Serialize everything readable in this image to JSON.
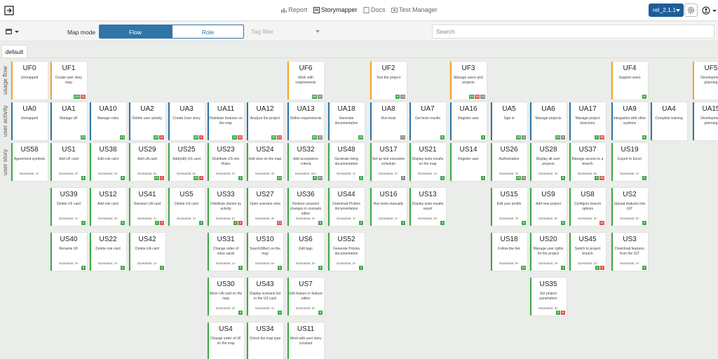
{
  "nav": {
    "report": "Report",
    "storymapper": "Storymapper",
    "docs": "Docs",
    "test_manager": "Test Manager"
  },
  "release": "rel_2.1.1",
  "toolbar": {
    "map_mode_label": "Map mode",
    "flow_label": "Flow",
    "role_label": "Role",
    "tag_filter_placeholder": "Tag filter",
    "search_placeholder": "Search"
  },
  "tab": "default",
  "row_labels": {
    "uf": "usage flow",
    "ua": "user activity",
    "us": "user story"
  },
  "colors": {
    "uf_bar": "#f4a52c",
    "ua_bar": "#2f75a6",
    "us_bar": "#3ea845",
    "green": "#3ea845",
    "red": "#e05050",
    "gray": "#888888"
  },
  "uf_cards": [
    {
      "id": "UF0",
      "desc": "Unmapped",
      "col": 0
    },
    {
      "id": "UF1",
      "desc": "Create user story map",
      "col": 1,
      "badges": [
        [
          "115",
          "green"
        ],
        [
          "10",
          "red"
        ]
      ]
    },
    {
      "id": "UF6",
      "desc": "Work with requirements",
      "col": 7,
      "badges": [
        [
          "66",
          "green"
        ],
        [
          "12",
          "gray"
        ]
      ]
    },
    {
      "id": "UF2",
      "desc": "Test the project",
      "col": 9,
      "badges": [
        [
          "8",
          "green"
        ],
        [
          "12",
          "gray"
        ]
      ]
    },
    {
      "id": "UF3",
      "desc": "Manage users and projects",
      "col": 11,
      "badges": [
        [
          "54",
          "green"
        ],
        [
          "36",
          "red"
        ],
        [
          "12",
          "gray"
        ]
      ]
    },
    {
      "id": "UF4",
      "desc": "Support users",
      "col": 15,
      "badges": [
        [
          "6",
          "green"
        ]
      ]
    },
    {
      "id": "UF5",
      "desc": "Development planning",
      "col": 17
    }
  ],
  "ua_cards": [
    {
      "id": "UA0",
      "desc": "Unmapped",
      "col": 0
    },
    {
      "id": "UA1",
      "desc": "Manage UF",
      "col": 1,
      "badges": [
        [
          "10",
          "green"
        ]
      ]
    },
    {
      "id": "UA10",
      "desc": "Manage roles",
      "col": 2,
      "badges": [
        [
          "14",
          "green"
        ]
      ]
    },
    {
      "id": "UA2",
      "desc": "Define user activity",
      "col": 3,
      "badges": [
        [
          "18",
          "green"
        ],
        [
          "12",
          "red"
        ]
      ]
    },
    {
      "id": "UA3",
      "desc": "Create User story",
      "col": 4,
      "badges": [
        [
          "20",
          "green"
        ],
        [
          "4",
          "red"
        ]
      ]
    },
    {
      "id": "UA11",
      "desc": "Distribute features on the map",
      "col": 5,
      "badges": [
        [
          "11",
          "green"
        ],
        [
          "10",
          "red"
        ]
      ]
    },
    {
      "id": "UA12",
      "desc": "Analyze the project",
      "col": 6,
      "badges": [
        [
          "34",
          "green"
        ],
        [
          "24",
          "red"
        ]
      ]
    },
    {
      "id": "UA13",
      "desc": "Define requirements",
      "col": 7,
      "badges": [
        [
          "56",
          "green"
        ],
        [
          "12",
          "gray"
        ]
      ]
    },
    {
      "id": "UA18",
      "desc": "Generate documentation",
      "col": 8,
      "badges": [
        [
          "10",
          "green"
        ]
      ]
    },
    {
      "id": "UA8",
      "desc": "Run tests",
      "col": 9,
      "badges": [
        [
          "12",
          "gray"
        ]
      ]
    },
    {
      "id": "UA7",
      "desc": "Get tests results",
      "col": 10,
      "badges": [
        [
          "8",
          "green"
        ]
      ]
    },
    {
      "id": "UA16",
      "desc": "Register user",
      "col": 11,
      "badges": [
        [
          "4",
          "green"
        ]
      ]
    },
    {
      "id": "UA5",
      "desc": "Sign in",
      "col": 12,
      "badges": [
        [
          "28",
          "green"
        ],
        [
          "4",
          "gray"
        ]
      ]
    },
    {
      "id": "UA6",
      "desc": "Manage projects",
      "col": 13,
      "badges": [
        [
          "20",
          "green"
        ],
        [
          "8",
          "gray"
        ]
      ]
    },
    {
      "id": "UA17",
      "desc": "Manage project branches",
      "col": 14,
      "badges": [
        [
          "2",
          "green"
        ],
        [
          "28",
          "red"
        ]
      ]
    },
    {
      "id": "UA9",
      "desc": "Integration with other systems",
      "col": 15,
      "badges": [
        [
          "6",
          "green"
        ]
      ]
    },
    {
      "id": "UA4",
      "desc": "Complete training",
      "col": 16
    },
    {
      "id": "UA15",
      "desc": "Development planning",
      "col": 17
    }
  ],
  "us_cards": [
    {
      "id": "US58",
      "desc": "Agreement symbols",
      "col": 0,
      "row": 0,
      "sc": "Scenarios: 1+"
    },
    {
      "id": "US1",
      "desc": "Add UF card",
      "col": 1,
      "row": 0,
      "sc": "Scenarios: 4+",
      "badges": [
        [
          "8",
          "green"
        ]
      ]
    },
    {
      "id": "US38",
      "desc": "Edit role card",
      "col": 2,
      "row": 0,
      "sc": "Scenarios: 3+",
      "badges": [
        [
          "6",
          "green"
        ]
      ]
    },
    {
      "id": "US29",
      "desc": "Add UA card",
      "col": 3,
      "row": 0,
      "sc": "Scenarios: 5+",
      "badges": [
        [
          "12",
          "green"
        ],
        [
          "4",
          "red"
        ]
      ]
    },
    {
      "id": "US25",
      "desc": "Add(edit) US card",
      "col": 4,
      "row": 0,
      "sc": "Scenarios: 6+",
      "badges": [
        [
          "16",
          "green"
        ],
        [
          "4",
          "red"
        ]
      ]
    },
    {
      "id": "US23",
      "desc": "Distribute US into Roles",
      "col": 5,
      "row": 0,
      "sc": "Scenarios: 2+",
      "badges": [
        [
          "2",
          "green"
        ]
      ]
    },
    {
      "id": "US24",
      "desc": "Add view on the map",
      "col": 6,
      "row": 0,
      "sc": "Scenarios: 3+",
      "badges": [
        [
          "14",
          "green"
        ]
      ]
    },
    {
      "id": "US32",
      "desc": "Add acceptance criteria",
      "col": 7,
      "row": 0,
      "sc": "Scenarios: 10+",
      "badges": [
        [
          "8",
          "green"
        ],
        [
          "24",
          "gray"
        ]
      ]
    },
    {
      "id": "US48",
      "desc": "Generate living documentation",
      "col": 8,
      "row": 0,
      "sc": "Scenarios: 1+",
      "badges": [
        [
          "2",
          "green"
        ]
      ]
    },
    {
      "id": "US17",
      "desc": "Set up test execution schedule",
      "col": 9,
      "row": 0,
      "sc": "Scenarios: 2+",
      "badges": [
        [
          "2",
          "gray"
        ]
      ]
    },
    {
      "id": "US21",
      "desc": "Display tests results on the map",
      "col": 10,
      "row": 0,
      "sc": "Scenarios: 1+",
      "badges": [
        [
          "4",
          "green"
        ]
      ]
    },
    {
      "id": "US14",
      "desc": "Register user",
      "col": 11,
      "row": 0,
      "sc": "",
      "badges": [
        [
          "4",
          "green"
        ]
      ]
    },
    {
      "id": "US26",
      "desc": "Authorization",
      "col": 12,
      "row": 0,
      "sc": "Scenarios: 3+",
      "badges": [
        [
          "10",
          "green"
        ],
        [
          "4",
          "gray"
        ]
      ]
    },
    {
      "id": "US28",
      "desc": "Display all user' projects",
      "col": 13,
      "row": 0,
      "sc": "Scenarios: 3+",
      "badges": [
        [
          "6",
          "green"
        ]
      ]
    },
    {
      "id": "US37",
      "desc": "Manage access to a branch",
      "col": 14,
      "row": 0,
      "sc": "Scenarios: 5+",
      "badges": [
        [
          "2",
          "green"
        ],
        [
          "28",
          "red"
        ]
      ]
    },
    {
      "id": "US19",
      "desc": "Export to Excel",
      "col": 15,
      "row": 0,
      "sc": "Scenarios: 1+",
      "badges": [
        [
          "2",
          "green"
        ]
      ]
    },
    {
      "id": "US39",
      "desc": "Delete UF card",
      "col": 1,
      "row": 1,
      "sc": "Scenarios: 1+",
      "badges": [
        [
          "4",
          "green"
        ]
      ]
    },
    {
      "id": "US12",
      "desc": "Add role card",
      "col": 2,
      "row": 1,
      "sc": "Scenarios: 3+",
      "badges": [
        [
          "6",
          "green"
        ]
      ]
    },
    {
      "id": "US41",
      "desc": "Rename UA card",
      "col": 3,
      "row": 1,
      "sc": "Scenarios: 1+",
      "badges": [
        [
          "2",
          "green"
        ],
        [
          "4",
          "red"
        ]
      ]
    },
    {
      "id": "US5",
      "desc": "Delete US card",
      "col": 4,
      "row": 1,
      "sc": "Scenarios: 1+",
      "badges": [
        [
          "4",
          "green"
        ]
      ]
    },
    {
      "id": "US33",
      "desc": "Distribute stories by activity",
      "col": 5,
      "row": 1,
      "sc": "Scenarios: 2+",
      "badges": [
        [
          "2",
          "green"
        ],
        [
          "2",
          "red"
        ]
      ]
    },
    {
      "id": "US27",
      "desc": "Open scenario view",
      "col": 6,
      "row": 1,
      "sc": "Scenarios: 3+",
      "badges": [
        [
          "24",
          "red"
        ]
      ]
    },
    {
      "id": "US36",
      "desc": "Restore unsaved changes in scenario editor",
      "col": 7,
      "row": 1,
      "sc": "Scenarios: 4+",
      "badges": [
        [
          "6",
          "green"
        ]
      ]
    },
    {
      "id": "US44",
      "desc": "Download Pickles documentation",
      "col": 8,
      "row": 1,
      "sc": "Scenarios: 1+",
      "badges": [
        [
          "4",
          "green"
        ]
      ]
    },
    {
      "id": "US16",
      "desc": "Run tests manually",
      "col": 9,
      "row": 1,
      "sc": "Scenarios: 1+",
      "badges": [
        [
          "4",
          "green"
        ]
      ]
    },
    {
      "id": "US13",
      "desc": "Display tests results report",
      "col": 10,
      "row": 1,
      "sc": "Scenarios: 3+",
      "badges": [
        [
          "4",
          "green"
        ]
      ]
    },
    {
      "id": "US15",
      "desc": "Edit user profile",
      "col": 12,
      "row": 1,
      "sc": "Scenarios: 3+",
      "badges": [
        [
          "6",
          "green"
        ]
      ]
    },
    {
      "id": "US9",
      "desc": "Add new project",
      "col": 13,
      "row": 1,
      "sc": "Scenarios: 5+",
      "badges": [
        [
          "8",
          "green"
        ]
      ]
    },
    {
      "id": "US8",
      "desc": "Configure branch options",
      "col": 14,
      "row": 1,
      "sc": "Scenarios: 3+",
      "badges": [
        [
          "12",
          "red"
        ]
      ]
    },
    {
      "id": "US2",
      "desc": "Upload features into GIT",
      "col": 15,
      "row": 1,
      "sc": "Scenarios: 2+",
      "badges": [
        [
          "4",
          "green"
        ]
      ]
    },
    {
      "id": "US40",
      "desc": "Rename UF",
      "col": 1,
      "row": 2,
      "sc": "Scenarios: 3+",
      "badges": [
        [
          "6",
          "green"
        ]
      ]
    },
    {
      "id": "US22",
      "desc": "Delete role card",
      "col": 2,
      "row": 2,
      "sc": "Scenarios: 1+",
      "badges": [
        [
          "2",
          "green"
        ]
      ]
    },
    {
      "id": "US42",
      "desc": "Delete UA card",
      "col": 3,
      "row": 2,
      "sc": "Scenarios: 1+",
      "badges": [
        [
          "4",
          "green"
        ]
      ]
    },
    {
      "id": "US31",
      "desc": "Change order of roles cards",
      "col": 5,
      "row": 2,
      "sc": "Scenarios: 1+",
      "badges": [
        [
          "2",
          "green"
        ]
      ]
    },
    {
      "id": "US10",
      "desc": "Search(filter) on the map",
      "col": 6,
      "row": 2,
      "sc": "Scenarios: 6+",
      "badges": [
        [
          "6",
          "green"
        ]
      ]
    },
    {
      "id": "US6",
      "desc": "Edit tags",
      "col": 7,
      "row": 2,
      "sc": "Scenarios: 3+",
      "badges": [
        [
          "6",
          "green"
        ]
      ]
    },
    {
      "id": "US52",
      "desc": "Generate Pickles documentation",
      "col": 8,
      "row": 2,
      "sc": "Scenarios: 2+",
      "badges": [
        [
          "4",
          "green"
        ]
      ]
    },
    {
      "id": "US18",
      "desc": "Follow the link",
      "col": 12,
      "row": 2,
      "sc": "Scenarios: 6+",
      "badges": [
        [
          "12",
          "green"
        ]
      ]
    },
    {
      "id": "US20",
      "desc": "Manage user rights for the project",
      "col": 13,
      "row": 2,
      "sc": "Scenarios: 3+",
      "badges": [
        [
          "4",
          "green"
        ]
      ]
    },
    {
      "id": "US45",
      "desc": "Switch to project branch",
      "col": 14,
      "row": 2,
      "sc": "Scenarios: 2+",
      "badges": [
        [
          "2",
          "green"
        ],
        [
          "4",
          "red"
        ]
      ]
    },
    {
      "id": "US3",
      "desc": "Download features from the GIT",
      "col": 15,
      "row": 2,
      "sc": "Scenarios: 2+",
      "badges": [
        [
          "4",
          "green"
        ]
      ]
    },
    {
      "id": "US30",
      "desc": "Move UA card on the map",
      "col": 5,
      "row": 3,
      "sc": "Scenarios: 2+",
      "badges": [
        [
          "4",
          "green"
        ]
      ]
    },
    {
      "id": "US43",
      "desc": "Display scenario list in the US card",
      "col": 6,
      "row": 3,
      "sc": "Scenarios: 1+",
      "badges": [
        [
          "4",
          "green"
        ]
      ]
    },
    {
      "id": "US7",
      "desc": "Edit feature in feature editor",
      "col": 7,
      "row": 3,
      "sc": "Scenarios: 2+",
      "badges": [
        [
          "6",
          "green"
        ]
      ]
    },
    {
      "id": "US35",
      "desc": "Set project parameters",
      "col": 13,
      "row": 3,
      "sc": "Scenarios: 3+",
      "badges": [
        [
          "2",
          "green"
        ],
        [
          "8",
          "red"
        ]
      ]
    },
    {
      "id": "US4",
      "desc": "Change order of UF on the map",
      "col": 5,
      "row": 4,
      "sc": ""
    },
    {
      "id": "US34",
      "desc": "Check the map type",
      "col": 6,
      "row": 4,
      "sc": ""
    },
    {
      "id": "US11",
      "desc": "Work with user story constant",
      "col": 7,
      "row": 4,
      "sc": ""
    }
  ]
}
